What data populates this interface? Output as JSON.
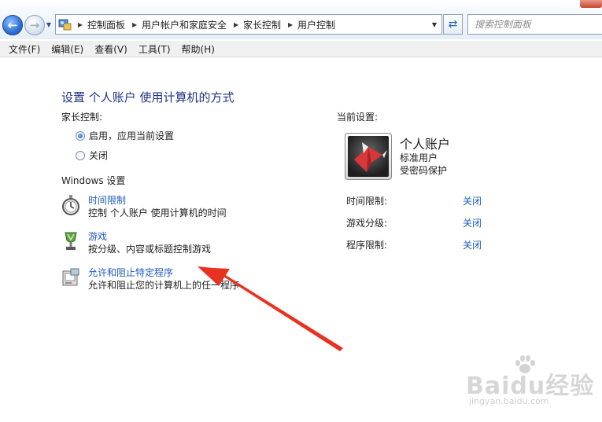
{
  "address": {
    "crumbs": [
      "控制面板",
      "用户帐户和家庭安全",
      "家长控制",
      "用户控制"
    ],
    "search_placeholder": "搜索控制面板"
  },
  "menu": [
    "文件(F)",
    "编辑(E)",
    "查看(V)",
    "工具(T)",
    "帮助(H)"
  ],
  "main": {
    "title": "设置 个人账户 使用计算机的方式",
    "parental_label": "家长控制:",
    "radio_on": "启用，应用当前设置",
    "radio_off": "关闭",
    "windows_settings_label": "Windows 设置",
    "tasks": [
      {
        "link": "时间限制",
        "desc": "控制 个人账户 使用计算机的时间"
      },
      {
        "link": "游戏",
        "desc": "按分级、内容或标题控制游戏"
      },
      {
        "link": "允许和阻止特定程序",
        "desc": "允许和阻止您的计算机上的任一程序"
      }
    ]
  },
  "current": {
    "label": "当前设置:",
    "account_name": "个人账户",
    "account_type": "标准用户",
    "account_protection": "受密码保护",
    "settings": [
      {
        "name": "时间限制:",
        "value": "关闭"
      },
      {
        "name": "游戏分级:",
        "value": "关闭"
      },
      {
        "name": "程序限制:",
        "value": "关闭"
      }
    ]
  },
  "watermark": {
    "text": "Baidu经验",
    "sub": "jingyan.baidu.com"
  },
  "colors": {
    "link": "#1e5bbb",
    "title": "#1e3287",
    "annotation": "#e8321f"
  }
}
